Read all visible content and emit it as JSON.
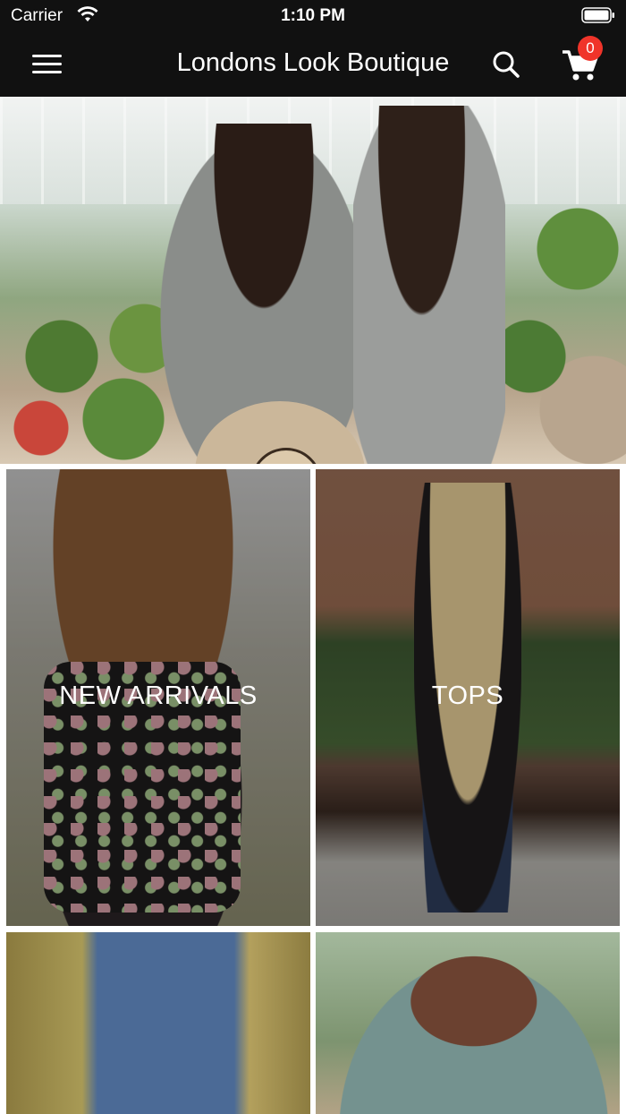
{
  "status_bar": {
    "carrier": "Carrier",
    "time": "1:10 PM",
    "wifi_icon": "wifi-icon",
    "battery_icon": "battery-icon"
  },
  "nav": {
    "title": "Londons Look Boutique",
    "menu_icon": "hamburger-menu-icon",
    "search_icon": "search-icon",
    "cart_icon": "shopping-cart-icon",
    "cart_count": "0"
  },
  "hero": {
    "slide_count": 2,
    "active_slide": 1
  },
  "categories": [
    {
      "label": "NEW ARRIVALS"
    },
    {
      "label": "TOPS"
    },
    {
      "label": ""
    },
    {
      "label": ""
    }
  ],
  "colors": {
    "bar_background": "#111111",
    "badge": "#f0342a",
    "text_on_dark": "#ffffff"
  }
}
